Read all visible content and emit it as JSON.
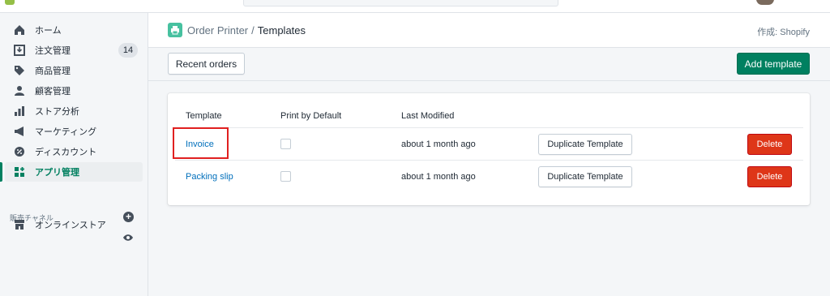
{
  "sidebar": {
    "items": [
      {
        "label": "ホーム",
        "icon": "home-icon"
      },
      {
        "label": "注文管理",
        "icon": "orders-icon",
        "badge": "14"
      },
      {
        "label": "商品管理",
        "icon": "tag-icon"
      },
      {
        "label": "顧客管理",
        "icon": "person-icon"
      },
      {
        "label": "ストア分析",
        "icon": "analytics-icon"
      },
      {
        "label": "マーケティング",
        "icon": "megaphone-icon"
      },
      {
        "label": "ディスカウント",
        "icon": "discount-icon"
      },
      {
        "label": "アプリ管理",
        "icon": "apps-icon",
        "active": true
      }
    ],
    "channels_title": "販売チャネル",
    "channel": {
      "label": "オンラインストア",
      "icon": "store-icon"
    }
  },
  "header": {
    "app_name": "Order Printer",
    "separator": "/",
    "page_title": "Templates",
    "by_text": "作成: Shopify"
  },
  "toolbar": {
    "recent_orders_label": "Recent orders",
    "add_template_label": "Add template"
  },
  "table": {
    "columns": [
      "Template",
      "Print by Default",
      "Last Modified"
    ],
    "rows": [
      {
        "name": "Invoice",
        "print_by_default": false,
        "last_modified": "about 1 month ago",
        "duplicate_label": "Duplicate Template",
        "delete_label": "Delete"
      },
      {
        "name": "Packing slip",
        "print_by_default": false,
        "last_modified": "about 1 month ago",
        "duplicate_label": "Duplicate Template",
        "delete_label": "Delete"
      }
    ]
  },
  "colors": {
    "accent": "#008060",
    "danger": "#de3618",
    "link": "#006fbb",
    "highlight": "#e02020"
  }
}
